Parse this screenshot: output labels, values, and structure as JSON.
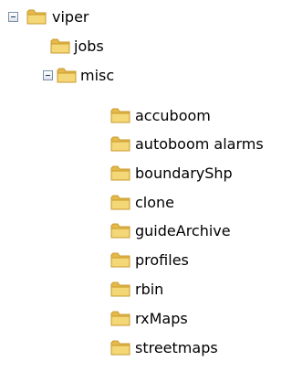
{
  "folder_icon": "folder-icon",
  "expand_icon": "minus-box-icon",
  "colors": {
    "folder_fill": "#f4d776",
    "folder_shade": "#e5b94a",
    "folder_edge": "#c99a2e",
    "toggle_border": "#7a8fa8"
  },
  "tree": {
    "root": {
      "label": "viper",
      "expanded": true,
      "children": {
        "jobs": {
          "label": "jobs"
        },
        "misc": {
          "label": "misc",
          "expanded": true,
          "children": [
            {
              "label": "accuboom"
            },
            {
              "label": "autoboom alarms"
            },
            {
              "label": "boundaryShp"
            },
            {
              "label": "clone"
            },
            {
              "label": "guideArchive"
            },
            {
              "label": "profiles"
            },
            {
              "label": "rbin"
            },
            {
              "label": "rxMaps"
            },
            {
              "label": "streetmaps"
            }
          ]
        }
      }
    }
  }
}
